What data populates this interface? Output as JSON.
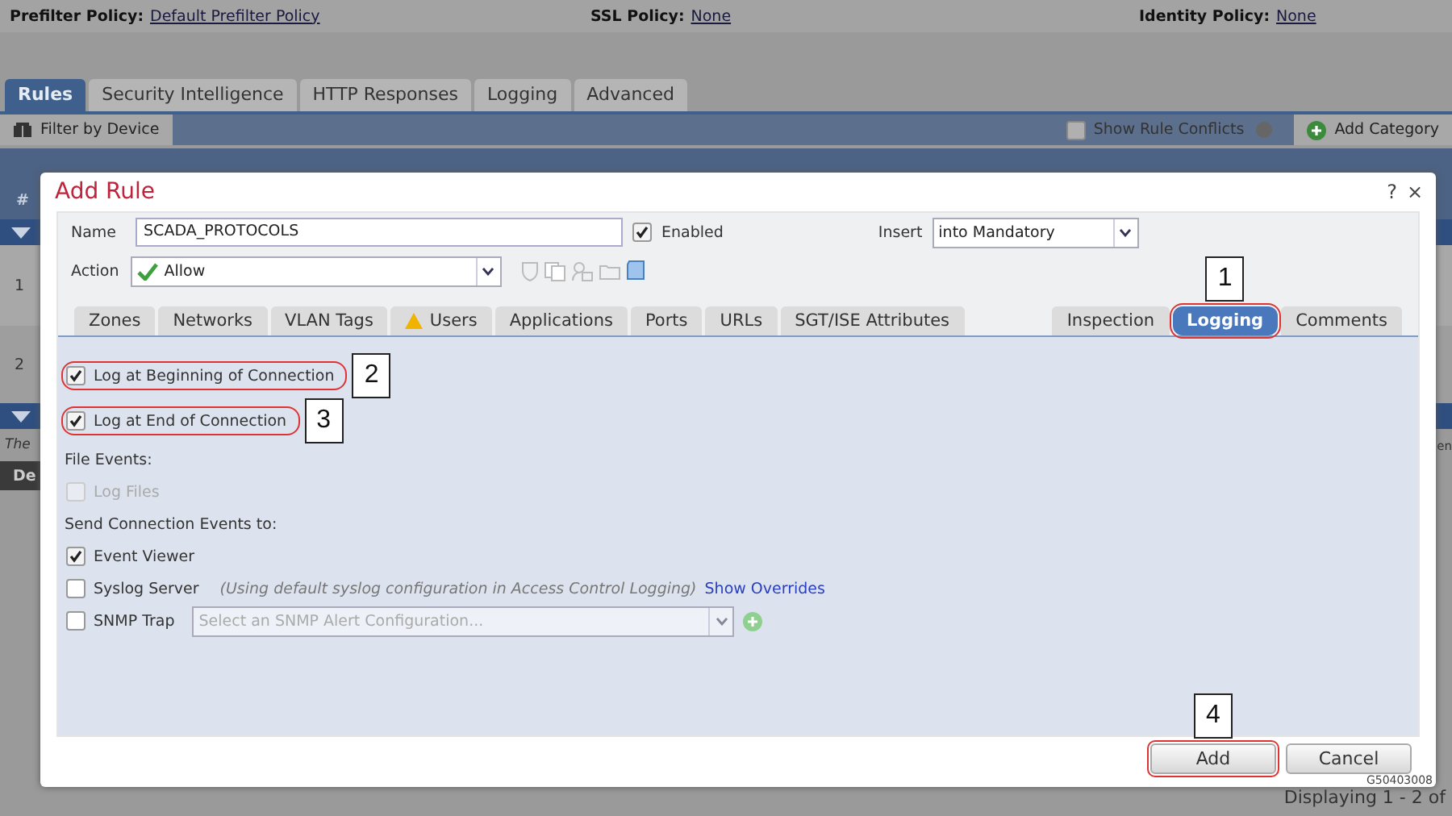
{
  "page": {
    "policies": [
      {
        "label": "Prefilter Policy:",
        "value": "Default Prefilter Policy"
      },
      {
        "label": "SSL Policy:",
        "value": "None"
      },
      {
        "label": "Identity Policy:",
        "value": "None"
      }
    ],
    "tabs": [
      {
        "label": "Rules",
        "selected": true
      },
      {
        "label": "Security Intelligence",
        "selected": false
      },
      {
        "label": "HTTP Responses",
        "selected": false
      },
      {
        "label": "Logging",
        "selected": false
      },
      {
        "label": "Advanced",
        "selected": false
      }
    ],
    "toolbar": {
      "filter_button": "Filter by Device",
      "show_conflicts": {
        "label": "Show Rule Conflicts",
        "checked": false
      },
      "add_category": "Add Category"
    },
    "table": {
      "header": "#",
      "rows": [
        "1",
        "2"
      ],
      "note": "The",
      "button": "De",
      "right_fragment": "en"
    },
    "status": "Displaying 1 - 2 of",
    "figure_id": "G50403008"
  },
  "dialog": {
    "title": "Add Rule",
    "help": "?",
    "close": "×",
    "name": {
      "label": "Name",
      "value": "SCADA_PROTOCOLS"
    },
    "enabled": {
      "label": "Enabled",
      "checked": true
    },
    "insert": {
      "label": "Insert",
      "value": "into Mandatory"
    },
    "action": {
      "label": "Action",
      "value": "Allow"
    },
    "tabs_left": [
      {
        "label": "Zones",
        "selected": false,
        "warning": false
      },
      {
        "label": "Networks",
        "selected": false,
        "warning": false
      },
      {
        "label": "VLAN Tags",
        "selected": false,
        "warning": false
      },
      {
        "label": "Users",
        "selected": false,
        "warning": true
      },
      {
        "label": "Applications",
        "selected": false,
        "warning": false
      },
      {
        "label": "Ports",
        "selected": false,
        "warning": false
      },
      {
        "label": "URLs",
        "selected": false,
        "warning": false
      },
      {
        "label": "SGT/ISE Attributes",
        "selected": false,
        "warning": false
      }
    ],
    "tabs_right": [
      {
        "label": "Inspection",
        "selected": false
      },
      {
        "label": "Logging",
        "selected": true,
        "highlighted": true,
        "callout": "1"
      },
      {
        "label": "Comments",
        "selected": false
      }
    ],
    "items": [
      {
        "kind": "check",
        "label": "Log at Beginning of Connection",
        "checked": true,
        "disabled": false,
        "highlighted": true,
        "callout": "2"
      },
      {
        "kind": "check",
        "label": "Log at End of Connection",
        "checked": true,
        "disabled": false,
        "highlighted": true,
        "callout": "3"
      },
      {
        "kind": "heading",
        "label": "File Events:"
      },
      {
        "kind": "check",
        "label": "Log Files",
        "checked": false,
        "disabled": true
      },
      {
        "kind": "heading",
        "label": "Send Connection Events to:"
      },
      {
        "kind": "check",
        "label": "Event Viewer",
        "checked": true,
        "disabled": false
      },
      {
        "kind": "syslog",
        "label": "Syslog Server",
        "checked": false,
        "disabled": false,
        "note": "(Using default syslog configuration in Access Control Logging)",
        "link": "Show Overrides"
      },
      {
        "kind": "snmp",
        "label": "SNMP Trap",
        "checked": false,
        "disabled": false,
        "placeholder": "Select an SNMP Alert Configuration..."
      }
    ],
    "buttons": [
      {
        "label": "Add",
        "highlighted": true,
        "callout": "4"
      },
      {
        "label": "Cancel",
        "highlighted": false
      }
    ]
  }
}
